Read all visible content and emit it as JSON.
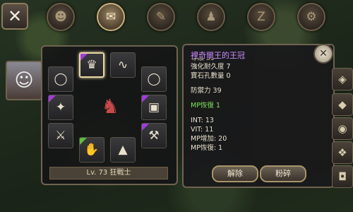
{
  "header": {
    "close_icon": "close-icon",
    "tabs": [
      {
        "icon": "head-icon",
        "glyph": "☻"
      },
      {
        "icon": "bag-icon",
        "glyph": "✉"
      },
      {
        "icon": "feather-icon",
        "glyph": "✎"
      },
      {
        "icon": "party-icon",
        "glyph": "♟"
      },
      {
        "icon": "scroll-icon",
        "glyph": "Z"
      },
      {
        "icon": "gear-icon",
        "glyph": "⚙"
      }
    ],
    "active_tab": 1
  },
  "equipment": {
    "level_text": "Lv. 73 狂戰士",
    "slots": [
      {
        "name": "helmet",
        "glyph": "♛",
        "rarity": "purple",
        "selected": true
      },
      {
        "name": "necklace",
        "glyph": "∿",
        "rarity": "none",
        "selected": false
      },
      {
        "name": "ring-left",
        "glyph": "◯",
        "rarity": "none",
        "selected": false
      },
      {
        "name": "ring-right",
        "glyph": "◯",
        "rarity": "none",
        "selected": false
      },
      {
        "name": "shoulder",
        "glyph": "✦",
        "rarity": "purple",
        "selected": false
      },
      {
        "name": "armor",
        "glyph": "▣",
        "rarity": "purple",
        "selected": false
      },
      {
        "name": "weapon-left",
        "glyph": "⚔",
        "rarity": "none",
        "selected": false
      },
      {
        "name": "weapon-right",
        "glyph": "⚒",
        "rarity": "purple",
        "selected": false
      },
      {
        "name": "gloves",
        "glyph": "✋",
        "rarity": "green",
        "selected": false
      },
      {
        "name": "boots",
        "glyph": "▲",
        "rarity": "none",
        "selected": false
      }
    ]
  },
  "item_info": {
    "title": "裡奇爾王的王冠",
    "lines": [
      {
        "text": "等級 55",
        "style": "dim"
      },
      {
        "text": "強化耐久度 7",
        "style": "normal"
      },
      {
        "text": "寶石孔數量 0",
        "style": "normal"
      },
      {
        "text": "",
        "style": "spacer"
      },
      {
        "text": "防禦力 39",
        "style": "normal"
      },
      {
        "text": "",
        "style": "spacer"
      },
      {
        "text": "MP恢復 1",
        "style": "green"
      },
      {
        "text": "",
        "style": "spacer"
      },
      {
        "text": "INT: 13",
        "style": "normal"
      },
      {
        "text": "VIT: 11",
        "style": "normal"
      },
      {
        "text": "MP增加: 20",
        "style": "normal"
      },
      {
        "text": "MP恢復: 1",
        "style": "normal"
      }
    ],
    "unequip_label": "解除",
    "crush_label": "粉碎"
  },
  "side_buttons": [
    {
      "icon": "shield-icon",
      "glyph": "◈"
    },
    {
      "icon": "cloak-icon",
      "glyph": "◆"
    },
    {
      "icon": "pet-icon",
      "glyph": "◉"
    },
    {
      "icon": "wing-icon",
      "glyph": "❖"
    },
    {
      "icon": "camera-icon",
      "glyph": "◘"
    }
  ]
}
